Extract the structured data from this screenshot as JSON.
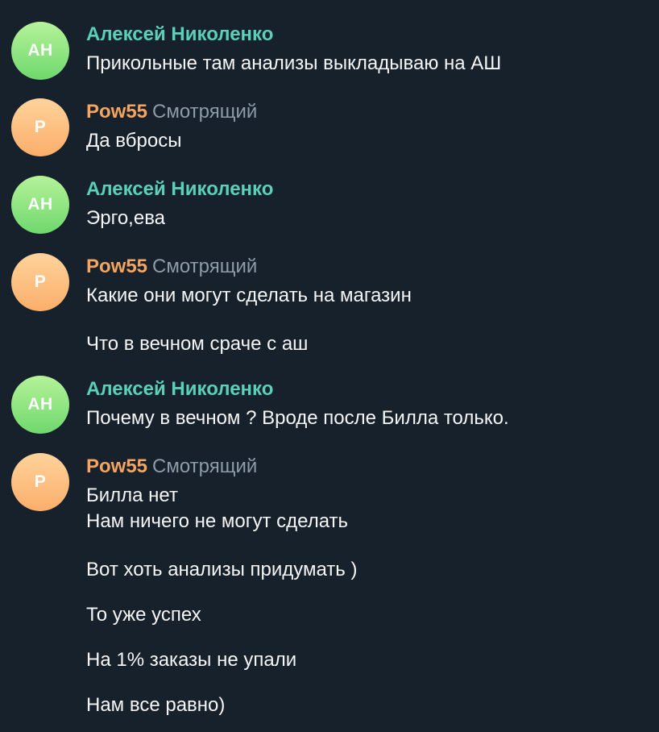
{
  "messages": [
    {
      "initials": "АН",
      "name": "Алексей Николенко",
      "role": "",
      "avatar_color": "green",
      "lines": [
        "Прикольные там анализы выкладываю на АШ"
      ]
    },
    {
      "initials": "P",
      "name": "Pow55",
      "role": "Смотрящий",
      "avatar_color": "orange",
      "lines": [
        "Да вбросы"
      ]
    },
    {
      "initials": "АН",
      "name": "Алексей Николенко",
      "role": "",
      "avatar_color": "green",
      "lines": [
        "Эрго,ева"
      ]
    },
    {
      "initials": "P",
      "name": "Pow55",
      "role": "Смотрящий",
      "avatar_color": "orange",
      "lines": [
        "Какие они могут сделать на магазин",
        "Что в вечном сраче с аш"
      ]
    },
    {
      "initials": "АН",
      "name": "Алексей Николенко",
      "role": "",
      "avatar_color": "green",
      "lines": [
        "Почему в вечном ? Вроде после Билла только."
      ]
    },
    {
      "initials": "P",
      "name": "Pow55",
      "role": "Смотрящий",
      "avatar_color": "orange",
      "lines": [
        "Билла нет",
        "Нам ничего не могут сделать",
        "Вот хоть анализы придумать )",
        "То уже успех",
        "На 1% заказы не упали",
        "Нам все равно)"
      ]
    }
  ],
  "colors": {
    "background": "#17212b",
    "name_green": "#5ad0b9",
    "name_orange": "#f5a55f",
    "role": "#8e9ba8",
    "text": "#f5f5f5"
  }
}
